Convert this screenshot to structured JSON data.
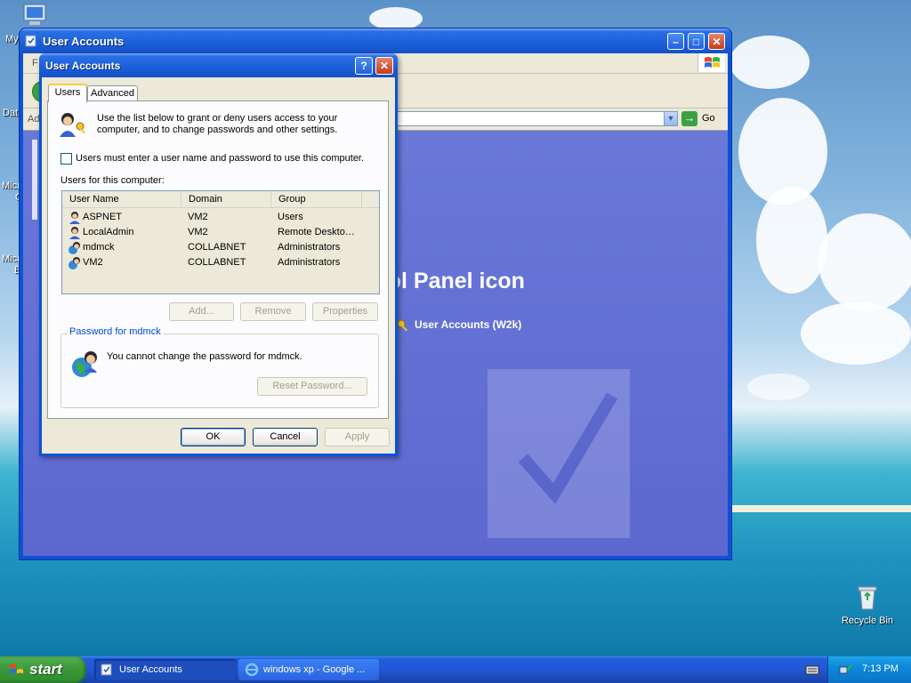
{
  "desktop": {
    "icons": [
      {
        "label": "My"
      },
      {
        "label": "Dat"
      },
      {
        "label": "Micro"
      },
      {
        "label": "C"
      },
      {
        "label": "Micro"
      },
      {
        "label": "B"
      },
      {
        "label": "Recycle Bin"
      }
    ]
  },
  "background_window": {
    "title": "User Accounts",
    "menu_first_letter": "F",
    "address_label": "Ad",
    "go_label": "Go",
    "heading_fragment": "rol Panel icon",
    "link_label": "User Accounts (W2k)"
  },
  "dialog": {
    "title": "User Accounts",
    "help_glyph": "?",
    "close_glyph": "✕",
    "tabs": [
      {
        "label": "Users",
        "active": true
      },
      {
        "label": "Advanced",
        "active": false
      }
    ],
    "intro_line1": "Use the list below to grant or deny users access to your",
    "intro_line2": "computer, and to change passwords and other settings.",
    "require_login_label": "Users must enter a user name and password to use this computer.",
    "require_login_checked": false,
    "users_label": "Users for this computer:",
    "columns": [
      "User Name",
      "Domain",
      "Group"
    ],
    "users": [
      {
        "name": "ASPNET",
        "domain": "VM2",
        "group": "Users"
      },
      {
        "name": "LocalAdmin",
        "domain": "VM2",
        "group": "Remote Deskto…"
      },
      {
        "name": "mdmck",
        "domain": "COLLABNET",
        "group": "Administrators"
      },
      {
        "name": "VM2",
        "domain": "COLLABNET",
        "group": "Administrators"
      }
    ],
    "add_label": "Add...",
    "remove_label": "Remove",
    "properties_label": "Properties",
    "password_group_label": "Password for mdmck",
    "password_message": "You cannot change the password for mdmck.",
    "reset_password_label": "Reset Password...",
    "ok_label": "OK",
    "cancel_label": "Cancel",
    "apply_label": "Apply"
  },
  "taskbar": {
    "start_label": "start",
    "tasks": [
      {
        "label": "User Accounts"
      },
      {
        "label": "windows xp - Google ..."
      }
    ],
    "clock": "7:13 PM"
  },
  "colors": {
    "xp_blue": "#0a53d6",
    "dialog_face": "#ece9d8",
    "start_green": "#3c9b3c",
    "tab_highlight": "#ffc83c"
  }
}
